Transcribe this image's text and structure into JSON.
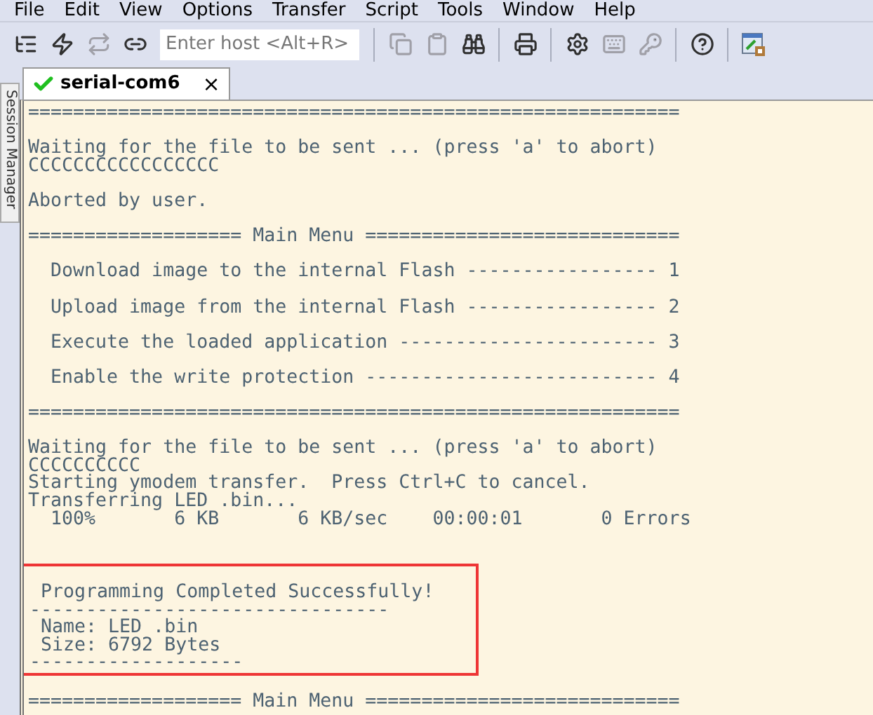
{
  "menu": [
    "File",
    "Edit",
    "View",
    "Options",
    "Transfer",
    "Script",
    "Tools",
    "Window",
    "Help"
  ],
  "toolbar": [
    {
      "kind": "tree",
      "disabled": false
    },
    {
      "kind": "bolt",
      "disabled": false
    },
    {
      "kind": "repeat",
      "disabled": true
    },
    {
      "kind": "link",
      "disabled": false
    },
    {
      "kind": "host"
    },
    {
      "kind": "sep"
    },
    {
      "kind": "copy",
      "disabled": true
    },
    {
      "kind": "paste",
      "disabled": true
    },
    {
      "kind": "binoculars",
      "disabled": false
    },
    {
      "kind": "sep"
    },
    {
      "kind": "printer",
      "disabled": false
    },
    {
      "kind": "sep"
    },
    {
      "kind": "gear",
      "disabled": false
    },
    {
      "kind": "keyboard",
      "disabled": true
    },
    {
      "kind": "key",
      "disabled": true
    },
    {
      "kind": "sep"
    },
    {
      "kind": "help",
      "disabled": false
    },
    {
      "kind": "sep"
    },
    {
      "kind": "lockwindow",
      "disabled": false
    }
  ],
  "host_field": {
    "placeholder": "Enter host <Alt+R>"
  },
  "tabs": [
    {
      "label": "serial-com6",
      "connected": true,
      "close": "×",
      "selected": true
    }
  ],
  "sidebar": {
    "label": "Session Manager"
  },
  "terminal": {
    "lines_before": [
      {
        "kind": "text",
        "text": "=========================================================="
      },
      {
        "kind": "blank"
      },
      {
        "kind": "text",
        "text": "Waiting for the file to be sent ... (press 'a' to abort)"
      },
      {
        "kind": "text",
        "text": "CCCCCCCCCCCCCCCCC"
      },
      {
        "kind": "blank"
      },
      {
        "kind": "text",
        "text": "Aborted by user."
      },
      {
        "kind": "blank"
      },
      {
        "kind": "text",
        "text": "=================== Main Menu ============================"
      },
      {
        "kind": "blank"
      },
      {
        "kind": "text",
        "text": "  Download image to the internal Flash ----------------- 1"
      },
      {
        "kind": "blank"
      },
      {
        "kind": "text",
        "text": "  Upload image from the internal Flash ----------------- 2"
      },
      {
        "kind": "blank"
      },
      {
        "kind": "text",
        "text": "  Execute the loaded application ----------------------- 3"
      },
      {
        "kind": "blank"
      },
      {
        "kind": "text",
        "text": "  Enable the write protection -------------------------- 4"
      },
      {
        "kind": "blank"
      },
      {
        "kind": "text",
        "text": "=========================================================="
      },
      {
        "kind": "blank"
      },
      {
        "kind": "text",
        "text": "Waiting for the file to be sent ... (press 'a' to abort)"
      },
      {
        "kind": "text",
        "text": "CCCCCCCCCC"
      },
      {
        "kind": "text",
        "text": "Starting ymodem transfer.  Press Ctrl+C to cancel."
      },
      {
        "kind": "text",
        "text": "Transferring LED .bin..."
      },
      {
        "kind": "text",
        "text": "  100%       6 KB       6 KB/sec    00:00:01       0 Errors"
      },
      {
        "kind": "blank"
      },
      {
        "kind": "blank"
      }
    ],
    "highlight": {
      "color": "#ee3535",
      "lines": [
        {
          "kind": "blank"
        },
        {
          "kind": "text",
          "text": " Programming Completed Successfully!"
        },
        {
          "kind": "text",
          "text": "--------------------------------"
        },
        {
          "kind": "text",
          "text": " Name: LED .bin"
        },
        {
          "kind": "text",
          "text": " Size: 6792 Bytes"
        },
        {
          "kind": "text",
          "text": "-------------------"
        }
      ]
    },
    "lines_after": [
      {
        "kind": "blank"
      },
      {
        "kind": "text",
        "text": "=================== Main Menu ============================"
      }
    ]
  }
}
